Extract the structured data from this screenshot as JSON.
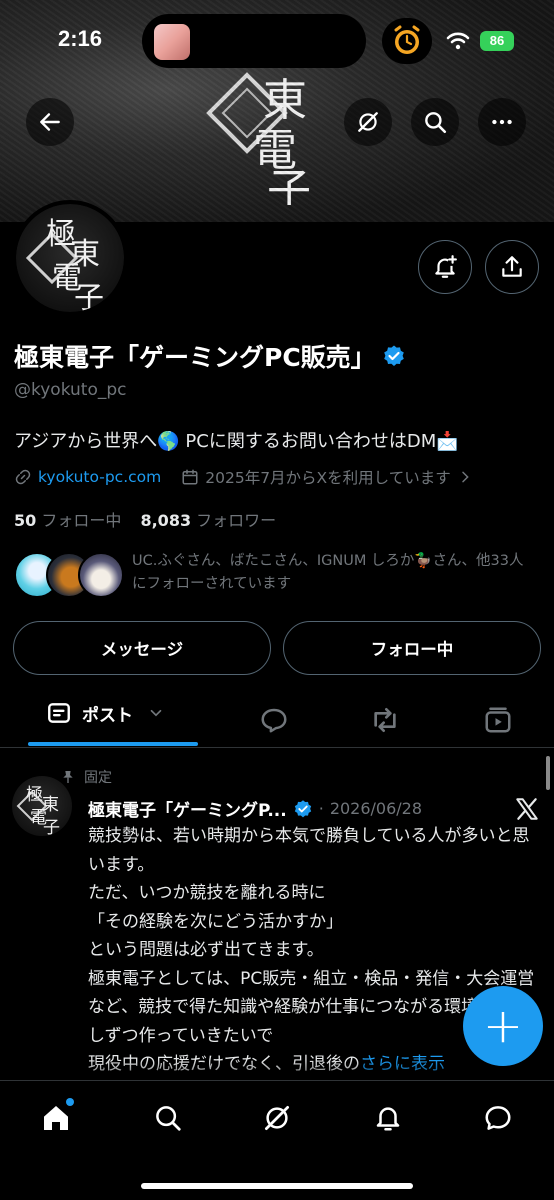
{
  "status_bar": {
    "time": "2:16",
    "battery": "86"
  },
  "banner": {
    "logo_chars": [
      "極",
      "東",
      "電",
      "子"
    ]
  },
  "profile": {
    "name": "極東電子「ゲーミングPC販売」",
    "handle": "@kyokuto_pc",
    "bio": "アジアから世界へ🌎 PCに関するお問い合わせはDM📩",
    "website": "kyokuto-pc.com",
    "joined": "2025年7月からXを利用しています",
    "following_count": "50",
    "following_label": "フォロー中",
    "followers_count": "8,083",
    "followers_label": "フォロワー",
    "mutual_text": "UC.ふぐさん、ばたこさん、IGNUM しろか🦆さん、他33人にフォローされています"
  },
  "buttons": {
    "message": "メッセージ",
    "following": "フォロー中"
  },
  "tabs": {
    "active_label": "ポスト"
  },
  "post": {
    "pinned_label": "固定",
    "author": "極東電子「ゲーミングP...",
    "separator": "·",
    "date": "2026/06/28",
    "body": "競技勢は、若い時期から本気で勝負している人が多いと思います。\nただ、いつか競技を離れる時に\n「その経験を次にどう活かすか」\nという問題は必ず出てきます。\n極東電子としては、PC販売・組立・検品・発信・大会運営など、競技で得た知識や経験が仕事につながる環境を、少しずつ作っていきたいで\n現役中の応援だけでなく、引退後の",
    "more_label": "さらに表示"
  },
  "fab": {
    "label": "+"
  },
  "colors": {
    "accent": "#1d9bf0",
    "background": "#000000",
    "muted": "#71767b",
    "battery": "#35d15a"
  },
  "icons": {
    "back": "arrow-left-icon",
    "grok": "grok-icon",
    "search": "search-icon",
    "more": "more-icon",
    "notify": "bell-plus-icon",
    "share": "share-icon",
    "verified": "verified-badge-icon",
    "link": "link-icon",
    "calendar": "calendar-icon",
    "chevron": "chevron-right-icon",
    "pin": "pin-icon",
    "x_logo": "x-logo-icon"
  }
}
